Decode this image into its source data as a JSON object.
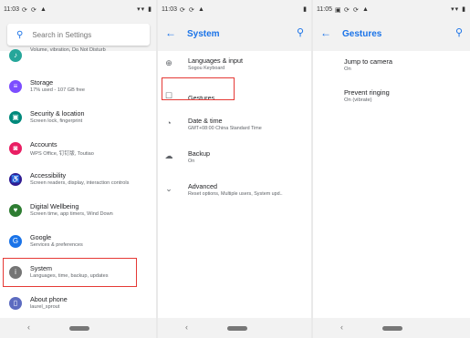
{
  "panel1": {
    "time": "11:03",
    "status_right": "▾▾ ▮",
    "search_placeholder": "Search in Settings",
    "items": [
      {
        "title": "",
        "subtitle": "Volume, vibration, Do Not Disturb",
        "color": "#26a69a",
        "icon": "sound-icon"
      },
      {
        "title": "Storage",
        "subtitle": "17% used - 107 GB free",
        "color": "#7c4dff",
        "icon": "storage-icon"
      },
      {
        "title": "Security & location",
        "subtitle": "Screen lock, fingerprint",
        "color": "#00897b",
        "icon": "lock-icon"
      },
      {
        "title": "Accounts",
        "subtitle": "WPS Office, 钉钉版, Toutiao",
        "color": "#e91e63",
        "icon": "account-icon"
      },
      {
        "title": "Accessibility",
        "subtitle": "Screen readers, display, interaction controls",
        "color": "#311b92",
        "icon": "accessibility-icon"
      },
      {
        "title": "Digital Wellbeing",
        "subtitle": "Screen time, app timers, Wind Down",
        "color": "#2e7d32",
        "icon": "wellbeing-icon"
      },
      {
        "title": "Google",
        "subtitle": "Services & preferences",
        "color": "#1a73e8",
        "icon": "google-icon"
      },
      {
        "title": "System",
        "subtitle": "Languages, time, backup, updates",
        "color": "#757575",
        "icon": "info-icon"
      },
      {
        "title": "About phone",
        "subtitle": "laurel_sprout",
        "color": "#5c6bc0",
        "icon": "phone-icon"
      }
    ]
  },
  "panel2": {
    "time": "11:03",
    "title": "System",
    "items": [
      {
        "title": "Languages & input",
        "subtitle": "Sogou Keyboard",
        "icon": "globe-icon"
      },
      {
        "title": "Gestures",
        "subtitle": "",
        "icon": "gestures-icon"
      },
      {
        "title": "Date & time",
        "subtitle": "GMT+08:00 China Standard Time",
        "icon": "clock-icon"
      },
      {
        "title": "Backup",
        "subtitle": "On",
        "icon": "cloud-backup-icon"
      },
      {
        "title": "Advanced",
        "subtitle": "Reset options, Multiple users, System upd..",
        "icon": "chevron-down-icon"
      }
    ]
  },
  "panel3": {
    "time": "11:05",
    "status_right": "▾▾ ▮",
    "title": "Gestures",
    "items": [
      {
        "title": "Jump to camera",
        "subtitle": "On"
      },
      {
        "title": "Prevent ringing",
        "subtitle": "On (vibrate)"
      }
    ]
  }
}
